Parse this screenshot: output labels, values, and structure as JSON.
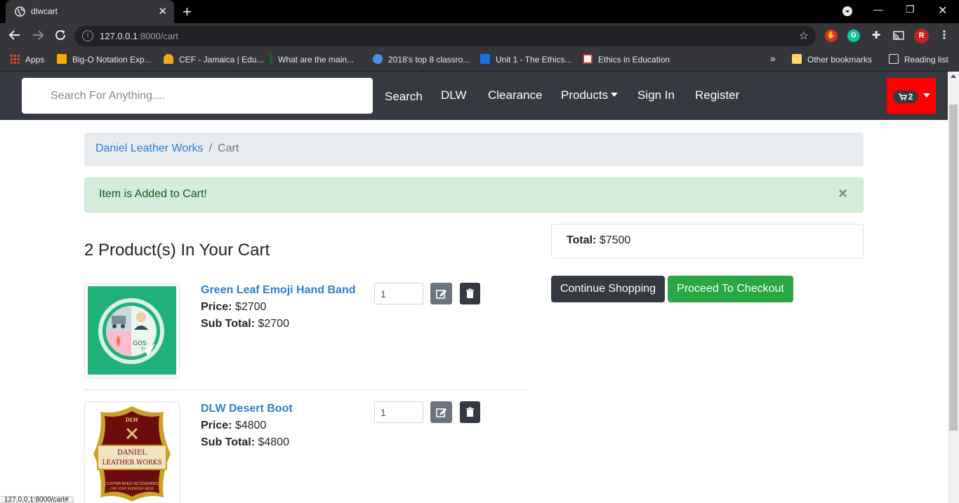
{
  "browser": {
    "tab_title": "dlwcart",
    "tab_close": "✕",
    "new_tab": "+",
    "url_host": "127.0.0.1",
    "url_path": ":8000/cart",
    "profile_initial": "R",
    "status_url": "127.0.0.1:8000/cart#",
    "bookmarks": {
      "apps": "Apps",
      "items": [
        "Big-O Notation Exp...",
        "CEF - Jamaica | Edu...",
        "What are the main...",
        "2018's top 8 classro...",
        "Unit 1 - The Ethics...",
        "Ethics in Education"
      ],
      "overflow": "»",
      "other": "Other bookmarks",
      "reading_list": "Reading list"
    }
  },
  "nav": {
    "search_placeholder": "Search For Anything....",
    "links": {
      "search": "Search",
      "dlw": "DLW",
      "clearance": "Clearance",
      "products": "Products",
      "signin": "Sign In",
      "register": "Register"
    },
    "cart_count": "2",
    "accent_color": "#ff0000"
  },
  "breadcrumb": {
    "home": "Daniel Leather Works",
    "separator": "/",
    "current": "Cart"
  },
  "alert": {
    "message": "Item is Added to Cart!",
    "close": "×"
  },
  "cart": {
    "heading": "2 Product(s) In Your Cart",
    "price_label": "Price:",
    "subtotal_label": "Sub Total:",
    "items": [
      {
        "name": "Green Leaf Emoji Hand Band",
        "price": "$2700",
        "subtotal": "$2700",
        "qty": "1",
        "image_icon": "green-leaf-emoji-image"
      },
      {
        "name": "DLW Desert Boot",
        "price": "$4800",
        "subtotal": "$4800",
        "qty": "1",
        "image_icon": "daniel-leather-works-logo",
        "image_text": [
          "DLW",
          "DANIEL",
          "LEATHER WORKS",
          "CUSTOM BUILD ACCESSORIES",
          "FOR YOUR EVERYDAY NEED"
        ]
      }
    ]
  },
  "summary": {
    "total_label": "Total:",
    "total_value": "$7500",
    "continue": "Continue Shopping",
    "checkout": "Proceed To Checkout"
  }
}
